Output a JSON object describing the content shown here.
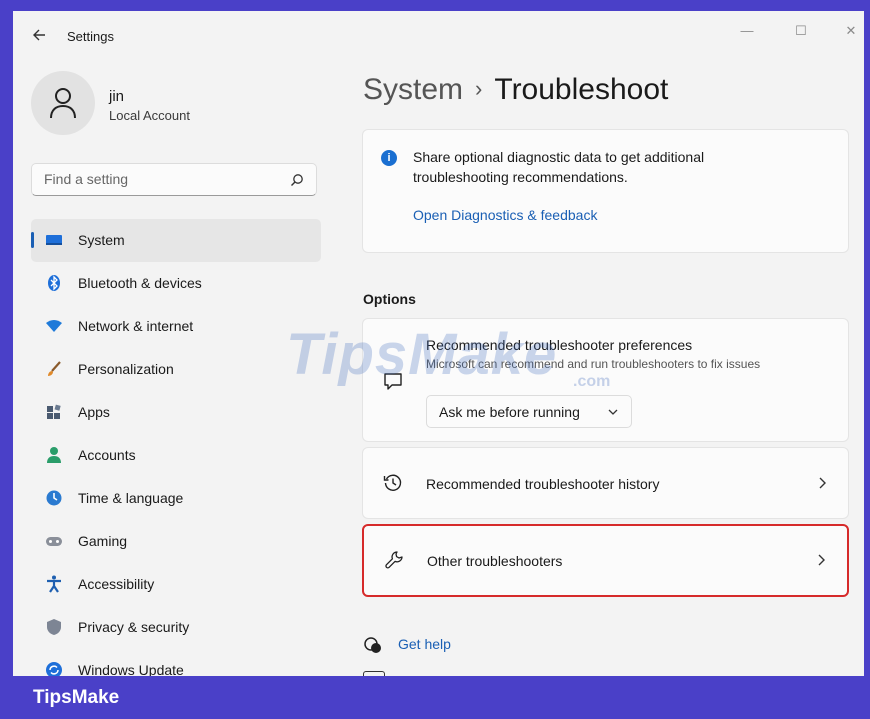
{
  "window": {
    "title": "Settings",
    "controls": {
      "minimize": "—",
      "maximize": "☐",
      "close": "✕"
    }
  },
  "profile": {
    "name": "jin",
    "account_type": "Local Account"
  },
  "search": {
    "placeholder": "Find a setting"
  },
  "sidebar": {
    "items": [
      {
        "label": "System",
        "icon": "monitor-icon",
        "selected": true
      },
      {
        "label": "Bluetooth & devices",
        "icon": "bluetooth-icon"
      },
      {
        "label": "Network & internet",
        "icon": "wifi-icon"
      },
      {
        "label": "Personalization",
        "icon": "brush-icon"
      },
      {
        "label": "Apps",
        "icon": "apps-icon"
      },
      {
        "label": "Accounts",
        "icon": "person-icon"
      },
      {
        "label": "Time & language",
        "icon": "globe-clock-icon"
      },
      {
        "label": "Gaming",
        "icon": "gamepad-icon"
      },
      {
        "label": "Accessibility",
        "icon": "accessibility-icon"
      },
      {
        "label": "Privacy & security",
        "icon": "shield-icon"
      },
      {
        "label": "Windows Update",
        "icon": "update-icon"
      }
    ]
  },
  "breadcrumb": {
    "parent": "System",
    "separator": "›",
    "current": "Troubleshoot"
  },
  "info_card": {
    "text": "Share optional diagnostic data to get additional troubleshooting recommendations.",
    "link": "Open Diagnostics & feedback"
  },
  "options": {
    "heading": "Options",
    "preferences": {
      "title": "Recommended troubleshooter preferences",
      "subtitle": "Microsoft can recommend and run troubleshooters to fix issues",
      "dropdown_value": "Ask me before running"
    },
    "history_label": "Recommended troubleshooter history",
    "other_label": "Other troubleshooters"
  },
  "help": {
    "get_help": "Get help"
  },
  "watermark": {
    "text": "TipsMake",
    "suffix": ".com"
  },
  "brand": {
    "text": "TipsMake"
  },
  "colors": {
    "frame": "#4a40c8",
    "accent": "#1a5fb4",
    "highlight_border": "#d62a2a"
  }
}
